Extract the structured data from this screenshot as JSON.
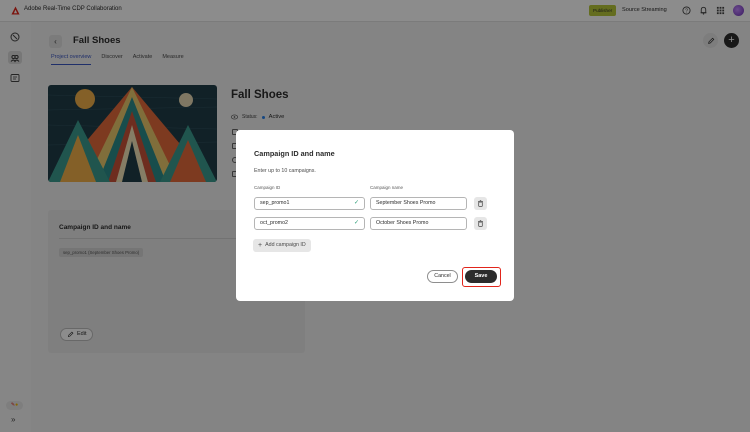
{
  "app": {
    "title": "Adobe Real-Time CDP Collaboration",
    "brand_color": "#e1251b",
    "badge": "Publisher",
    "source": "Source Streaming"
  },
  "header_icons": [
    "help-icon",
    "bell-icon",
    "apps-grid-icon"
  ],
  "rail": {
    "items": [
      "compass-icon",
      "collaboration-icon",
      "audience-list-icon"
    ],
    "bottom_badge_icons": [
      "tools-icon",
      "emoji-icon"
    ],
    "expand_label": "»"
  },
  "page": {
    "back_icon": "chevron-left-icon",
    "title": "Fall Shoes",
    "tabs": [
      {
        "label": "Project overview",
        "active": true
      },
      {
        "label": "Discover",
        "active": false
      },
      {
        "label": "Activate",
        "active": false
      },
      {
        "label": "Measure",
        "active": false
      }
    ]
  },
  "project": {
    "name": "Fall Shoes",
    "status_label": "Status:",
    "status_value": "Active",
    "status_color": "#2680eb"
  },
  "card": {
    "title": "Campaign ID and name",
    "tag": "sep_promo1 (September Shoes Promo)",
    "edit_label": "Edit"
  },
  "dialog": {
    "title": "Campaign ID and name",
    "description": "Enter up to 10 campaigns.",
    "col_campaign_id": "Campaign ID",
    "col_campaign_name": "Campaign name",
    "rows": [
      {
        "id": "sep_promo1",
        "name": "September Shoes Promo"
      },
      {
        "id": "oct_promo2",
        "name": "October Shoes Promo"
      }
    ],
    "add_label": "Add campaign ID",
    "cancel_label": "Cancel",
    "save_label": "Save",
    "highlight_color": "#e1251b"
  }
}
